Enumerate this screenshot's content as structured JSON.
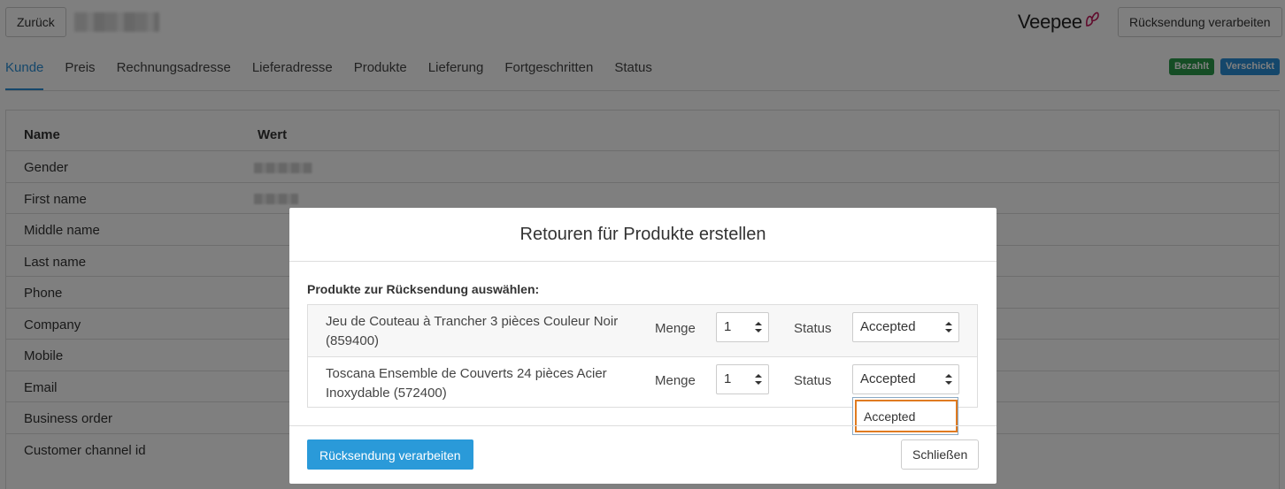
{
  "header": {
    "back_label": "Zurück",
    "logo_text": "Veepee",
    "process_label": "Rücksendung verarbeiten"
  },
  "tabs": [
    {
      "label": "Kunde",
      "active": true
    },
    {
      "label": "Preis"
    },
    {
      "label": "Rechnungsadresse"
    },
    {
      "label": "Lieferadresse"
    },
    {
      "label": "Produkte"
    },
    {
      "label": "Lieferung"
    },
    {
      "label": "Fortgeschritten"
    },
    {
      "label": "Status"
    }
  ],
  "badges": {
    "paid": "Bezahlt",
    "shipped": "Verschickt"
  },
  "table": {
    "col_name": "Name",
    "col_value": "Wert",
    "rows": [
      "Gender",
      "First name",
      "Middle name",
      "Last name",
      "Phone",
      "Company",
      "Mobile",
      "Email",
      "Business order",
      "Customer channel id"
    ]
  },
  "modal": {
    "title": "Retouren für Produkte erstellen",
    "section_label": "Produkte zur Rücksendung auswählen:",
    "qty_label": "Menge",
    "status_label": "Status",
    "products": [
      {
        "name": "Jeu de Couteau à Trancher 3 pièces Couleur Noir (859400)",
        "qty": "1",
        "status": "Accepted"
      },
      {
        "name": "Toscana Ensemble de Couverts 24 pièces Acier Inoxydable (572400)",
        "qty": "1",
        "status": "Accepted"
      }
    ],
    "dropdown_option": "Accepted",
    "submit_label": "Rücksendung verarbeiten",
    "close_label": "Schließen"
  },
  "colors": {
    "accent": "#2a8fd6",
    "paid": "#2b9a4b",
    "highlight": "#e07b21"
  }
}
